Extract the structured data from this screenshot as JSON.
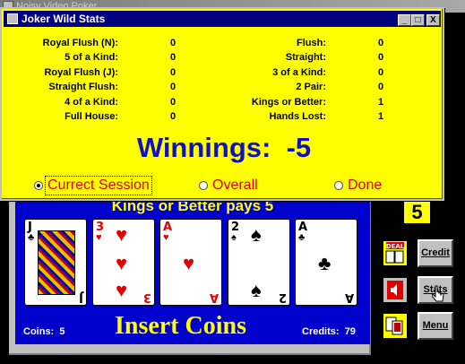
{
  "main_window": {
    "title": "Noisy Video Poker"
  },
  "stats_dialog": {
    "title": "Joker Wild Stats",
    "minimize": "_",
    "maximize": "□",
    "close": "X",
    "left_stats": [
      {
        "label": "Royal Flush (N):",
        "value": "0"
      },
      {
        "label": "5 of a Kind:",
        "value": "0"
      },
      {
        "label": "Royal Flush (J):",
        "value": "0"
      },
      {
        "label": "Straight Flush:",
        "value": "0"
      },
      {
        "label": "4 of a Kind:",
        "value": "0"
      },
      {
        "label": "Full House:",
        "value": "0"
      }
    ],
    "right_stats": [
      {
        "label": "Flush:",
        "value": "0"
      },
      {
        "label": "Straight:",
        "value": "0"
      },
      {
        "label": "3 of a Kind:",
        "value": "0"
      },
      {
        "label": "2 Pair:",
        "value": "0"
      },
      {
        "label": "Kings or Better:",
        "value": "1"
      },
      {
        "label": "Hands Lost:",
        "value": "1"
      }
    ],
    "winnings_label": "Winnings:",
    "winnings_value": "-5",
    "options": [
      {
        "label": "Currect Session",
        "selected": true
      },
      {
        "label": "Overall",
        "selected": false
      },
      {
        "label": "Done",
        "selected": false
      }
    ]
  },
  "game": {
    "pays_message": "Kings or Better pays 5",
    "bet_digit": "5",
    "cards": [
      {
        "rank": "J",
        "suit": "♣",
        "color": "black",
        "face": true
      },
      {
        "rank": "3",
        "suit": "♥",
        "color": "red",
        "face": false
      },
      {
        "rank": "A",
        "suit": "♥",
        "color": "red",
        "face": false
      },
      {
        "rank": "2",
        "suit": "♠",
        "color": "black",
        "face": false
      },
      {
        "rank": "A",
        "suit": "♣",
        "color": "black",
        "face": false
      }
    ],
    "coins_label": "Coins:",
    "coins_value": "5",
    "insert_coins": "Insert Coins",
    "credits_label": "Credits:",
    "credits_value": "79",
    "buttons": {
      "credit": "Credit",
      "stats": "Stats",
      "menu": "Menu",
      "deal_icon": "deal-icon",
      "sound_icon": "speaker-icon",
      "cards_icon": "cards-icon"
    }
  }
}
